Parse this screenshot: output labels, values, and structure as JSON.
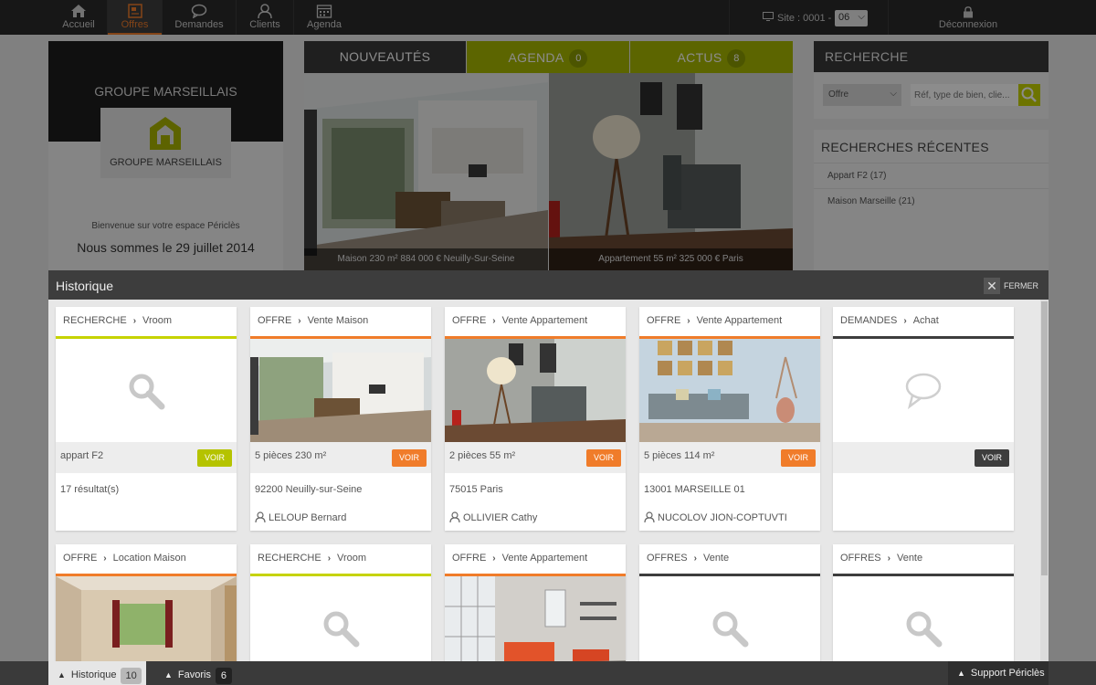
{
  "nav": {
    "items": [
      {
        "label": "Accueil",
        "icon": "home-icon"
      },
      {
        "label": "Offres",
        "icon": "document-icon"
      },
      {
        "label": "Demandes",
        "icon": "speech-bubble-icon"
      },
      {
        "label": "Clients",
        "icon": "user-icon"
      },
      {
        "label": "Agenda",
        "icon": "calendar-icon"
      }
    ],
    "active": "Offres",
    "site_label": "Site : 0001 -",
    "site_value": "06",
    "logout_label": "Déconnexion",
    "accent_color": "#f07c2a"
  },
  "company": {
    "name": "GROUPE MARSEILLAIS",
    "logo_text": "GROUPE MARSEILLAIS",
    "welcome": "Bienvenue sur votre espace Périclès",
    "date_line": "Nous sommes le 29 juillet 2014"
  },
  "tabs": [
    {
      "label": "NOUVEAUTÉS",
      "count": ""
    },
    {
      "label": "AGENDA",
      "count": "0"
    },
    {
      "label": "ACTUS",
      "count": "8"
    }
  ],
  "heroes": [
    {
      "caption": "Maison 230 m² 884 000 € Neuilly-Sur-Seine"
    },
    {
      "caption": "Appartement 55 m² 325 000 € Paris"
    }
  ],
  "search": {
    "title": "RECHERCHE",
    "select_value": "Offre",
    "placeholder": "Réf, type de bien, clie..."
  },
  "recent": {
    "title": "RECHERCHES RÉCENTES",
    "items": [
      "Appart F2 (17)",
      "Maison Marseille (21)"
    ]
  },
  "historique": {
    "title": "Historique",
    "close_label": "FERMER",
    "cards": [
      {
        "category": "RECHERCHE",
        "subcategory": "Vroom",
        "summary": "appart F2",
        "voir": "VOIR",
        "location": "17 résultat(s)",
        "agent": "",
        "kind": "search"
      },
      {
        "category": "OFFRE",
        "subcategory": "Vente Maison",
        "summary": "5 pièces 230 m²",
        "voir": "VOIR",
        "location": "92200 Neuilly-sur-Seine",
        "agent": "LELOUP Bernard",
        "kind": "house"
      },
      {
        "category": "OFFRE",
        "subcategory": "Vente Appartement",
        "summary": "2 pièces 55 m²",
        "voir": "VOIR",
        "location": "75015 Paris",
        "agent": "OLLIVIER Cathy",
        "kind": "apartment"
      },
      {
        "category": "OFFRE",
        "subcategory": "Vente Appartement",
        "summary": "5 pièces 114 m²",
        "voir": "VOIR",
        "location": "13001 MARSEILLE 01",
        "agent": "NUCOLOV JION-COPTUVTI",
        "kind": "living"
      },
      {
        "category": "DEMANDES",
        "subcategory": "Achat",
        "summary": "",
        "voir": "VOIR",
        "location": "",
        "agent": "",
        "kind": "demand"
      },
      {
        "category": "OFFRE",
        "subcategory": "Location Maison",
        "kind": "room"
      },
      {
        "category": "RECHERCHE",
        "subcategory": "Vroom",
        "kind": "search"
      },
      {
        "category": "OFFRE",
        "subcategory": "Vente Appartement",
        "kind": "loft"
      },
      {
        "category": "OFFRES",
        "subcategory": "Vente",
        "kind": "search-dark"
      },
      {
        "category": "OFFRES",
        "subcategory": "Vente",
        "kind": "search-dark"
      }
    ]
  },
  "bottom": {
    "historique_label": "Historique",
    "historique_count": "10",
    "favoris_label": "Favoris",
    "favoris_count": "6",
    "support_label": "Support Périclès"
  },
  "colors": {
    "recherche": "#c6d300",
    "offre": "#f07c2a",
    "demandes": "#3d3d3d",
    "green_tab": "#a8b800"
  }
}
